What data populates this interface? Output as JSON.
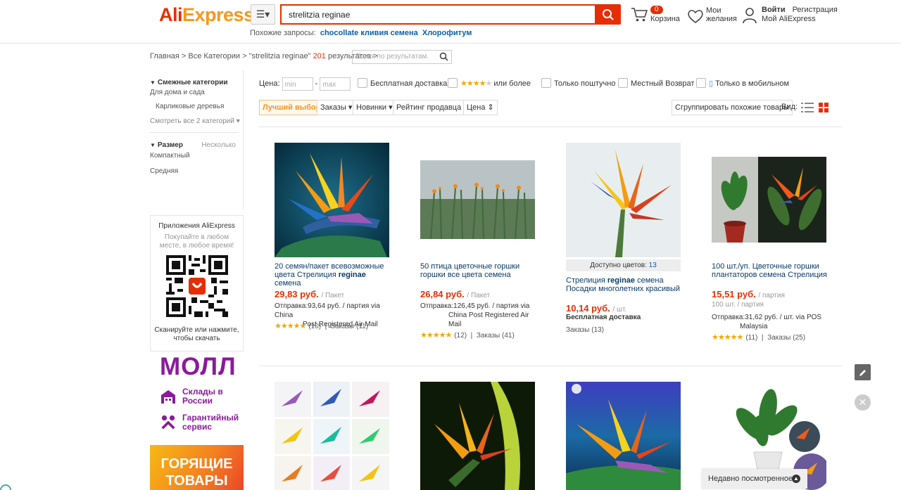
{
  "header": {
    "logo_ali": "Ali",
    "logo_express": "Express",
    "search_value": "strelitzia reginae",
    "related_label": "Похожие запросы:",
    "related": [
      "chocollate кливия семена",
      "Хлорофитум"
    ],
    "cart_count": "0",
    "cart_label": "Корзина",
    "wish_label": "Мои желания",
    "login": "Войти",
    "register": "Регистрация",
    "my_account": "Мой AliExpress"
  },
  "breadcrumb": {
    "home": "Главная",
    "all_cats": "Все Категории",
    "query": "\"strelitzia reginae\"",
    "count": "201",
    "results": "результатов",
    "search_placeholder": "Поиск по результатам."
  },
  "sidebar": {
    "related_cats_title": "Смежные категории",
    "cat_home": "Для дома и сада",
    "cat_sub": "Карликовые деревья",
    "see_all": "Смотреть все 2 категорий",
    "size_title": "Размер",
    "size_multi": "Несколько",
    "size_items": [
      "Компактный",
      "Средняя"
    ],
    "app_title": "Приложения AliExpress",
    "app_desc": "Покупайте в любом месте, в любое время!",
    "app_scan": "Сканируйте или нажмите, чтобы скачать",
    "mall": "МОЛЛ",
    "promo1": "Склады в России",
    "promo2": "Гарантийный сервис",
    "hot": "ГОРЯЩИЕ ТОВАРЫ"
  },
  "filters": {
    "price_label": "Цена:",
    "min_placeholder": "min",
    "max_placeholder": "max",
    "free_shipping": "Бесплатная доставка",
    "rating_more": "или более",
    "single_only": "Только поштучно",
    "local_return": "Местный Возврат",
    "mobile_only": "Только в мобильном"
  },
  "sort": {
    "best": "Лучший выбор",
    "orders": "Заказы",
    "new": "Новинки",
    "seller_rating": "Рейтинг продавца",
    "price": "Цена",
    "group": "Сгруппировать похожие товары",
    "view": "Вид:"
  },
  "products": [
    {
      "title_pre": "20 семян/пакет всевозможные цвета Стрелиция",
      "title_bold": "reginae",
      "title_post": "семена",
      "price": "29,83 руб.",
      "unit": "/ Пакет",
      "ship_line1": "Отправка:93,64 руб. / партия via China",
      "ship_line2": "Post Registered Air Mail",
      "rating": "(10)",
      "orders": "Заказы (11)"
    },
    {
      "title_pre": "50 птица цветочные горшки горшки все цвета семена",
      "title_bold": "",
      "title_post": "",
      "price": "26,84 руб.",
      "unit": "/ Пакет",
      "ship_line1": "Отправка:126,45 руб. / партия via",
      "ship_line2": "China Post Registered Air Mail",
      "rating": "(12)",
      "orders": "Заказы (41)"
    },
    {
      "colors_label": "Доступно цветов:",
      "colors_count": "13",
      "title_pre": "Стрелиция",
      "title_bold": "reginae",
      "title_post": "семена Посадки многолетних красивый",
      "price": "10,14 руб.",
      "unit": "/ шт.",
      "free": "Бесплатная доставка",
      "orders": "Заказы (13)"
    },
    {
      "title_pre": "100 шт./уп. Цветочные горшки плантаторов семена Стрелиция",
      "title_bold": "",
      "title_post": "",
      "price": "15,51 руб.",
      "unit": "/ партия",
      "old_price": "100 шт. / партия",
      "ship_line1": "Отправка:31,62 руб. / шт. via POS",
      "ship_line2": "Malaysia",
      "rating": "(11)",
      "orders": "Заказы (25)"
    }
  ],
  "recent": "Недавно посмотренное"
}
